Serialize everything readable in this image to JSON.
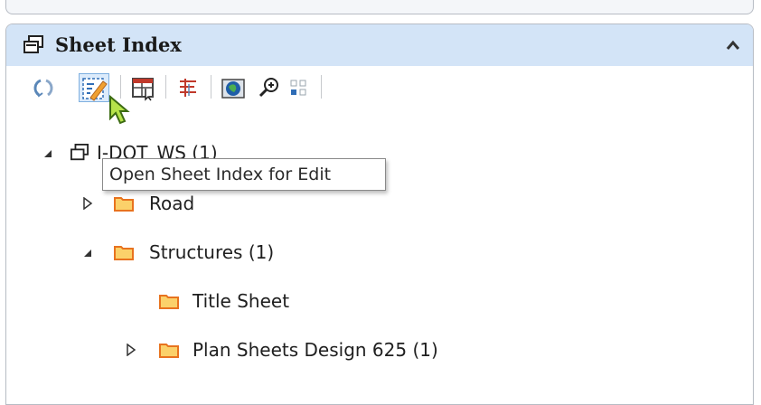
{
  "panel": {
    "title": "Sheet Index",
    "header_icon": "sheet-index-icon",
    "collapse_icon": "chevron-up-icon"
  },
  "toolbar": {
    "buttons": [
      {
        "name": "refresh-button",
        "icon": "refresh-icon"
      },
      {
        "name": "open-sheet-index-for-edit-button",
        "icon": "edit-sheet-icon",
        "active": true
      },
      {
        "name": "sheet-layout-button",
        "icon": "table-cursor-icon"
      },
      {
        "name": "sheet-properties-button",
        "icon": "list-tree-icon"
      },
      {
        "name": "open-dgn-button",
        "icon": "globe-icon"
      },
      {
        "name": "zoom-button",
        "icon": "zoom-in-icon"
      },
      {
        "name": "grid-button",
        "icon": "grid-icon"
      }
    ]
  },
  "tooltip": {
    "text": "Open Sheet Index for Edit"
  },
  "tree": {
    "root": {
      "label": "I-DOT_WS (1)",
      "expanded": true
    },
    "items": [
      {
        "label": "Road",
        "expanded": false,
        "has_children": true
      },
      {
        "label": "Structures (1)",
        "expanded": true,
        "has_children": true
      },
      {
        "label": "Title Sheet",
        "has_children": false
      },
      {
        "label": "Plan Sheets Design 625 (1)",
        "expanded": false,
        "has_children": true
      }
    ]
  },
  "colors": {
    "header_bg": "#d3e4f7",
    "folder_fill": "#fbd16a",
    "folder_stroke": "#e8731f",
    "active_button_bg": "#dcebfb"
  }
}
